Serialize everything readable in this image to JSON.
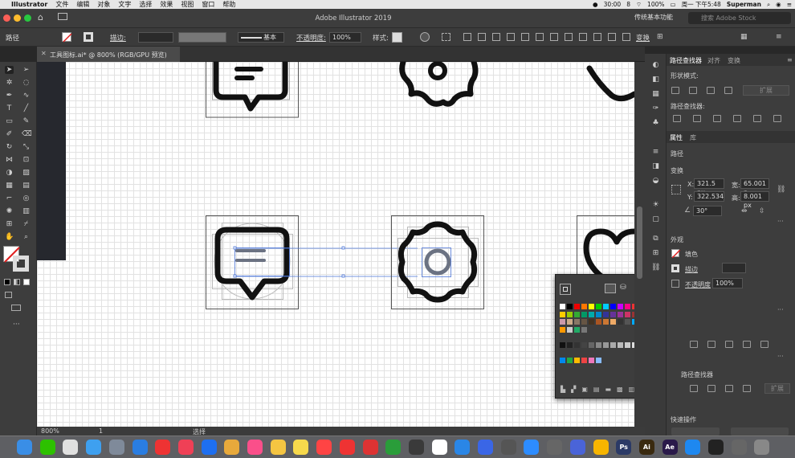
{
  "menubar": {
    "app": "Illustrator",
    "items": [
      "文件",
      "编辑",
      "对象",
      "文字",
      "选择",
      "效果",
      "视图",
      "窗口",
      "帮助"
    ],
    "status": {
      "time_small": "30:00",
      "count": "8",
      "battery": "100%",
      "clock": "周一 下午5:48",
      "user": "Superman"
    }
  },
  "titlebar": {
    "title": "Adobe Illustrator 2019",
    "workspace": "传统基本功能",
    "stock_placeholder": "搜索 Adobe Stock"
  },
  "controlbar": {
    "type_label": "路径",
    "stroke_label": "描边:",
    "stroke_style": "基本",
    "opacity_label": "不透明度:",
    "opacity_value": "100%",
    "style_label": "样式:",
    "transform_label": "变换"
  },
  "document_tab": {
    "label": "工具图标.ai* @ 800% (RGB/GPU 预览)"
  },
  "statusbar": {
    "zoom": "800%",
    "page": "1",
    "tool": "选择"
  },
  "right_panel": {
    "tabs": [
      "路径查找器",
      "对齐",
      "变换"
    ],
    "shape_modes_label": "形状模式:",
    "expand_label": "扩展",
    "pathfinder_label": "路径查找器:",
    "props_tabs": [
      "属性",
      "库"
    ],
    "path_label": "路径",
    "transform_label": "变换",
    "x_label": "X:",
    "x_value": "321.5 px",
    "y_label": "Y:",
    "y_value": "322.534",
    "w_label": "宽:",
    "w_value": "65.001 p",
    "h_label": "高:",
    "h_value": "8.001 px",
    "angle_value": "30°",
    "appearance_label": "外观",
    "fill_label": "填色",
    "stroke_label": "描边",
    "opacity_label": "不透明度",
    "opacity_value": "100%",
    "pathfinder2_label": "路径查找器",
    "expand2_label": "扩展",
    "quick_actions_label": "快速操作",
    "more": "···"
  },
  "dock": {
    "apps": [
      {
        "name": "Finder",
        "color": "#3a8ee6"
      },
      {
        "name": "WeChat",
        "color": "#2dc100"
      },
      {
        "name": "Tasks",
        "color": "#e0e0e0"
      },
      {
        "name": "Weather",
        "color": "#3ea0f0"
      },
      {
        "name": "Launchpad",
        "color": "#7f8a9a"
      },
      {
        "name": "Safari",
        "color": "#2a7de1"
      },
      {
        "name": "Music163",
        "color": "#e33"
      },
      {
        "name": "Pocket",
        "color": "#ef4056"
      },
      {
        "name": "QQBrowser",
        "color": "#1e6ff0"
      },
      {
        "name": "Chrome",
        "color": "#e8a93b"
      },
      {
        "name": "iTunes",
        "color": "#fa4f8a"
      },
      {
        "name": "Photos",
        "color": "#f5c542"
      },
      {
        "name": "Notes",
        "color": "#f7d94c"
      },
      {
        "name": "Reminders",
        "color": "#f44"
      },
      {
        "name": "Netease",
        "color": "#e33"
      },
      {
        "name": "Youdao",
        "color": "#d33"
      },
      {
        "name": "WeChatWork",
        "color": "#2a9d3a"
      },
      {
        "name": "Butterfly",
        "color": "#3a3a3a"
      },
      {
        "name": "Notion",
        "color": "#ffffff"
      },
      {
        "name": "Keynote",
        "color": "#2a86e6"
      },
      {
        "name": "Pages",
        "color": "#3a66e6"
      },
      {
        "name": "Typora",
        "color": "#555"
      },
      {
        "name": "Zoom",
        "color": "#2d8cff"
      },
      {
        "name": "Pen",
        "color": "#666"
      },
      {
        "name": "Affinity",
        "color": "#4a64d8"
      },
      {
        "name": "Sketch",
        "color": "#f7b500"
      },
      {
        "name": "Ps",
        "color": "#2b3a66"
      },
      {
        "name": "Ai",
        "color": "#3a2a10"
      },
      {
        "name": "Ae",
        "color": "#2a1a4a"
      },
      {
        "name": "AppStore",
        "color": "#1e88f0"
      },
      {
        "name": "Terminal",
        "color": "#222"
      },
      {
        "name": "Preview",
        "color": "#666"
      },
      {
        "name": "Trash",
        "color": "#888"
      }
    ],
    "ps_label": "Ps",
    "ai_label": "Ai",
    "ae_label": "Ae"
  },
  "colors": {
    "accent": "#2d7de8",
    "selection": "#4a74d8",
    "icon_stroke": "#111111",
    "selected_circle": "#6b7282"
  }
}
